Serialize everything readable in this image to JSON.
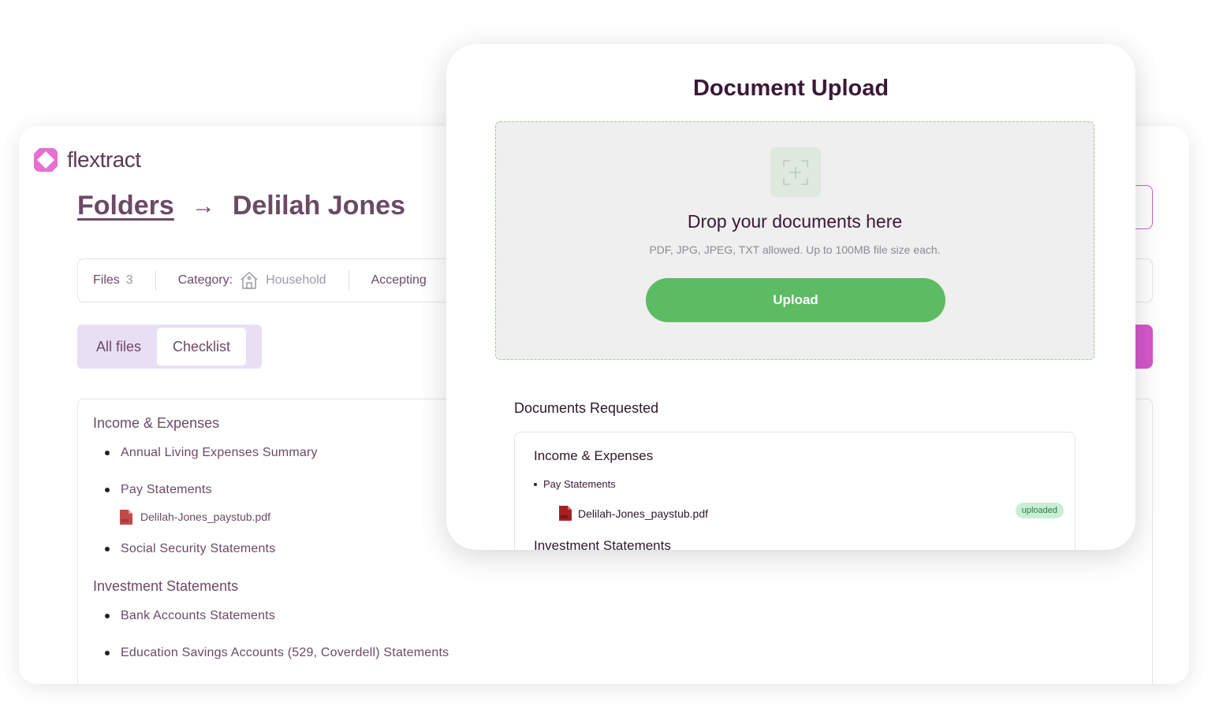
{
  "app": {
    "brand": "flextract",
    "breadcrumb": {
      "parent": "Folders",
      "current": "Delilah Jones"
    },
    "infobar": {
      "files_label": "Files",
      "files_count": "3",
      "category_label": "Category:",
      "category_value": "Household",
      "accepting_label": "Accepting"
    },
    "tabs": [
      "All files",
      "Checklist"
    ],
    "checklist": {
      "sections": [
        {
          "title": "Income & Expenses",
          "items": [
            "Annual Living Expenses Summary",
            "Pay Statements",
            "Social Security Statements"
          ],
          "file": "Delilah-Jones_paystub.pdf"
        },
        {
          "title": "Investment Statements",
          "items": [
            "Bank Accounts Statements",
            "Education Savings Accounts (529, Coverdell) Statements"
          ]
        }
      ]
    }
  },
  "modal": {
    "title": "Document Upload",
    "dropzone": {
      "title": "Drop your documents here",
      "subtitle": "PDF, JPG, JPEG, TXT allowed. Up to 100MB file size each.",
      "button": "Upload"
    },
    "requested": {
      "title": "Documents Requested",
      "section1": "Income & Expenses",
      "item1": "Pay Statements",
      "file": "Delilah-Jones_paystub.pdf",
      "badge": "uploaded",
      "section2": "Investment Statements"
    }
  },
  "colors": {
    "accent": "#d657cc",
    "brand_text": "#6b4a66",
    "upload_green": "#5dbb63",
    "title_dark": "#3b1836"
  }
}
